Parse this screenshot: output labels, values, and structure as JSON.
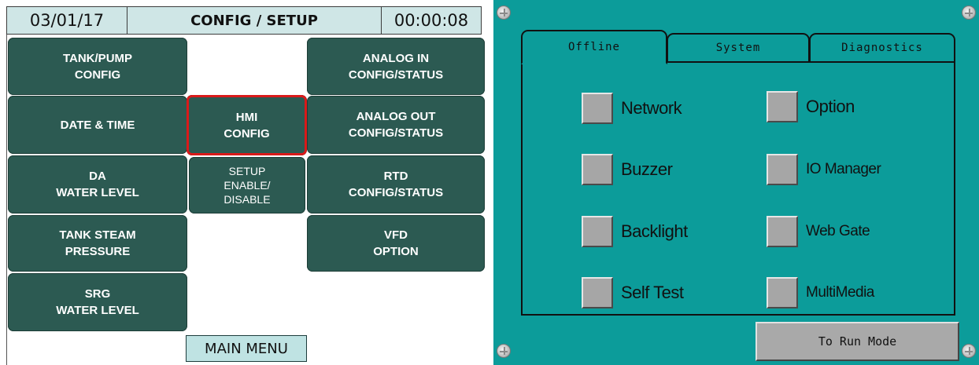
{
  "left_panel": {
    "header": {
      "date": "03/01/17",
      "title": "CONFIG / SETUP",
      "time": "00:00:08"
    },
    "tiles": [
      {
        "line1": "TANK/PUMP",
        "line2": "CONFIG",
        "line3": ""
      },
      {
        "line1": "DATE & TIME",
        "line2": "",
        "line3": ""
      },
      {
        "line1": "DA",
        "line2": "WATER LEVEL",
        "line3": ""
      },
      {
        "line1": "TANK STEAM",
        "line2": "PRESSURE",
        "line3": ""
      },
      {
        "line1": "SRG",
        "line2": "WATER LEVEL",
        "line3": ""
      },
      {
        "line1": "HMI",
        "line2": "CONFIG",
        "line3": ""
      },
      {
        "line1": "SETUP",
        "line2": "ENABLE/",
        "line3": "DISABLE"
      },
      {
        "line1": "ANALOG IN",
        "line2": "CONFIG/STATUS",
        "line3": ""
      },
      {
        "line1": "ANALOG OUT",
        "line2": "CONFIG/STATUS",
        "line3": ""
      },
      {
        "line1": "RTD",
        "line2": "CONFIG/STATUS",
        "line3": ""
      },
      {
        "line1": "VFD",
        "line2": "OPTION",
        "line3": ""
      }
    ],
    "main_menu_label": "MAIN MENU",
    "selected_tile": "HMI CONFIG",
    "colors": {
      "tile": "#2c5a52",
      "header": "#cfe6e6",
      "selection": "#d91a1a"
    }
  },
  "right_panel": {
    "tabs": [
      {
        "label": "Offline",
        "active": true
      },
      {
        "label": "System",
        "active": false
      },
      {
        "label": "Diagnostics",
        "active": false
      }
    ],
    "options": [
      {
        "label": "Network"
      },
      {
        "label": "Buzzer"
      },
      {
        "label": "Backlight"
      },
      {
        "label": "Self Test"
      },
      {
        "label": "Option"
      },
      {
        "label": "IO Manager"
      },
      {
        "label": "Web Gate"
      },
      {
        "label": "MultiMedia"
      }
    ],
    "run_mode_label": "To Run Mode",
    "colors": {
      "background": "#0c9c9a",
      "button": "#a9a9a9"
    }
  }
}
